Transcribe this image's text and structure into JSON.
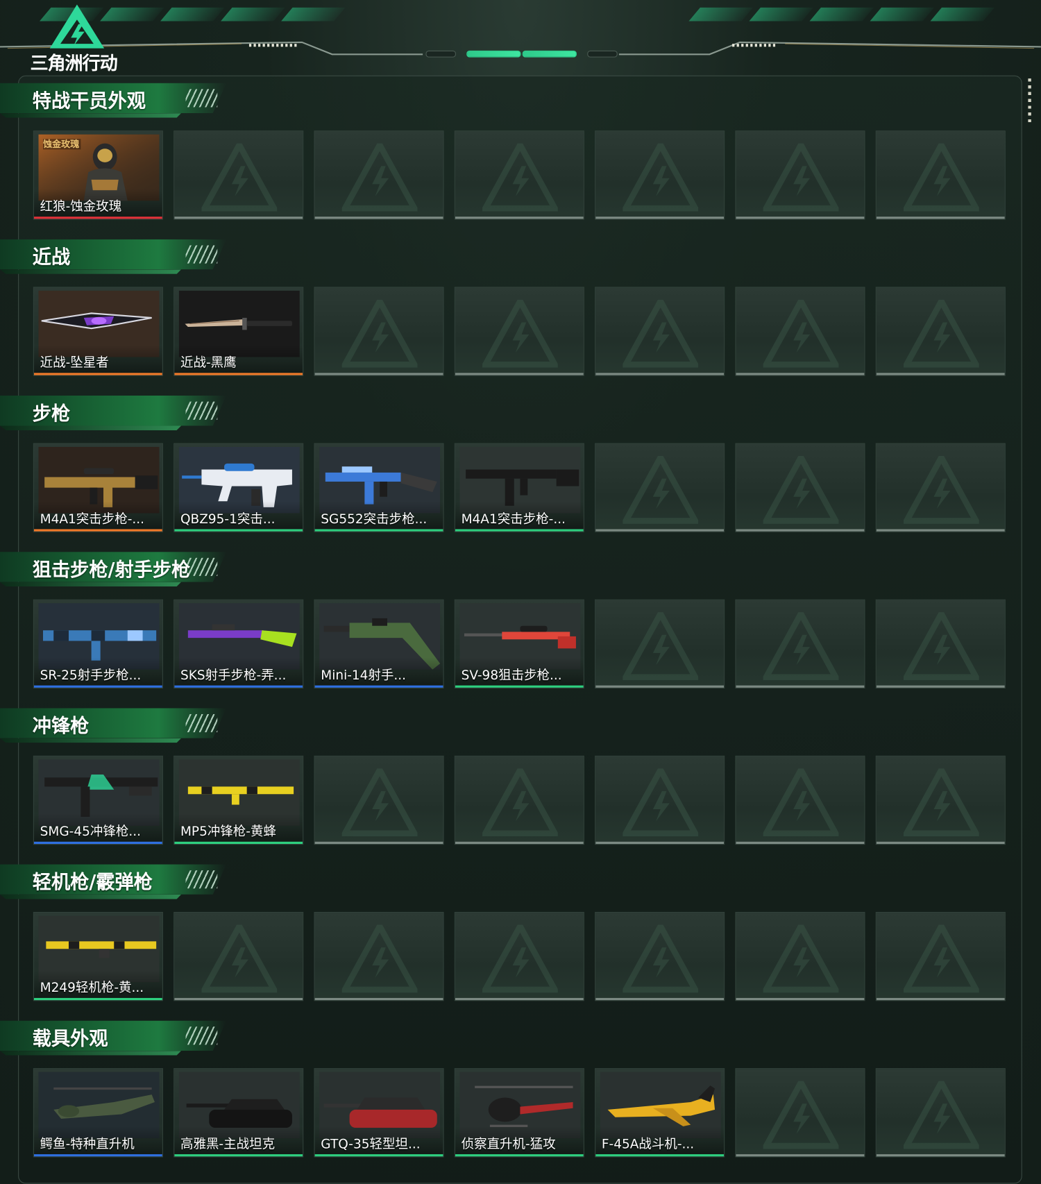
{
  "app": {
    "logo_text": "三角洲行动"
  },
  "categories": [
    {
      "title": "特战干员外观",
      "slots": 7,
      "items": [
        {
          "label": "红狼-蚀金玫瑰",
          "rarity_color": "#e0323a",
          "art": "operator",
          "badge": "蚀金玫瑰"
        }
      ]
    },
    {
      "title": "近战",
      "slots": 7,
      "items": [
        {
          "label": "近战-坠星者",
          "rarity_color": "#f07a2a",
          "art": "blade"
        },
        {
          "label": "近战-黑鹰",
          "rarity_color": "#f07a2a",
          "art": "knife"
        }
      ]
    },
    {
      "title": "步枪",
      "slots": 7,
      "items": [
        {
          "label": "M4A1突击步枪-...",
          "rarity_color": "#f07a2a",
          "art": "rifle_gold"
        },
        {
          "label": "QBZ95-1突击...",
          "rarity_color": "#2ecf7f",
          "art": "bullpup"
        },
        {
          "label": "SG552突击步枪...",
          "rarity_color": "#2ecf7f",
          "art": "rifle_blue"
        },
        {
          "label": "M4A1突击步枪-...",
          "rarity_color": "#2ecf7f",
          "art": "rifle_black"
        }
      ]
    },
    {
      "title": "狙击步枪/射手步枪",
      "slots": 7,
      "items": [
        {
          "label": "SR-25射手步枪...",
          "rarity_color": "#2f6fe0",
          "art": "dmr_camo"
        },
        {
          "label": "SKS射手步枪-弄...",
          "rarity_color": "#2f6fe0",
          "art": "sks"
        },
        {
          "label": "Mini-14射手...",
          "rarity_color": "#2f6fe0",
          "art": "mini14"
        },
        {
          "label": "SV-98狙击步枪...",
          "rarity_color": "#2ecf7f",
          "art": "sniper_red"
        }
      ]
    },
    {
      "title": "冲锋枪",
      "slots": 7,
      "items": [
        {
          "label": "SMG-45冲锋枪...",
          "rarity_color": "#2f6fe0",
          "art": "smg"
        },
        {
          "label": "MP5冲锋枪-黄蜂",
          "rarity_color": "#2ecf7f",
          "art": "mp5"
        }
      ]
    },
    {
      "title": "轻机枪/霰弹枪",
      "slots": 7,
      "items": [
        {
          "label": "M249轻机枪-黄...",
          "rarity_color": "#2ecf7f",
          "art": "lmg"
        }
      ]
    },
    {
      "title": "载具外观",
      "slots": 7,
      "items": [
        {
          "label": "鳄鱼-特种直升机",
          "rarity_color": "#2f6fe0",
          "art": "helicopter"
        },
        {
          "label": "高雅黑-主战坦克",
          "rarity_color": "#2ecf7f",
          "art": "tank_black"
        },
        {
          "label": "GTQ-35轻型坦...",
          "rarity_color": "#2ecf7f",
          "art": "tank_red"
        },
        {
          "label": "侦察直升机-猛攻",
          "rarity_color": "#2ecf7f",
          "art": "scout_heli"
        },
        {
          "label": "F-45A战斗机-...",
          "rarity_color": "#2ecf7f",
          "art": "jet"
        }
      ]
    }
  ]
}
